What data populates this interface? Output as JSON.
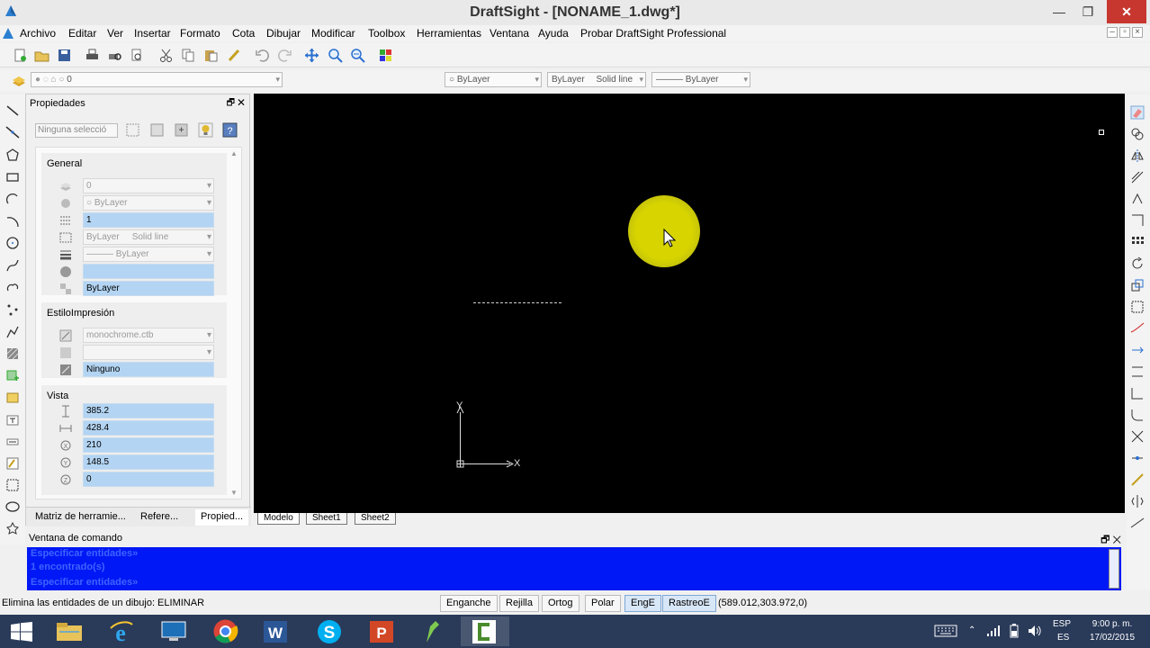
{
  "window": {
    "title": "DraftSight - [NONAME_1.dwg*]",
    "minimize_label": "—",
    "restore_label": "❐",
    "close_label": "✕"
  },
  "menu": [
    "Archivo",
    "Editar",
    "Ver",
    "Insertar",
    "Formato",
    "Cota",
    "Dibujar",
    "Modificar",
    "Toolbox",
    "Herramientas",
    "Ventana",
    "Ayuda",
    "Probar DraftSight Professional"
  ],
  "layer_bar": {
    "layer_value": "0",
    "color_combo": "ByLayer",
    "linestyle_combo_left": "ByLayer",
    "linestyle_combo_right": "Solid line",
    "lineweight_combo": "——— ByLayer"
  },
  "properties_panel": {
    "title": "Propiedades",
    "close_label": "✕",
    "float_label": "🗗",
    "selection_combo": "Ninguna selecció",
    "general": {
      "title": "General",
      "layer": "0",
      "color": "ByLayer",
      "linescale": "1",
      "linestyle_left": "ByLayer",
      "linestyle_right": "Solid line",
      "lineweight": "——— ByLayer",
      "thickness": "",
      "transparency": "ByLayer"
    },
    "print_style": {
      "title": "EstiloImpresión",
      "table": "monochrome.ctb",
      "style": "",
      "value": "Ninguno"
    },
    "view": {
      "title": "Vista",
      "height": "385.2",
      "width": "428.4",
      "center_x": "210",
      "center_y": "148.5",
      "center_z": "0"
    },
    "tabs": [
      "Matriz de herramie...",
      "Refere...",
      "Propied..."
    ]
  },
  "canvas": {
    "axis_y_label": "Y",
    "axis_x_label": "X"
  },
  "sheet_tabs": [
    "Modelo",
    "Sheet1",
    "Sheet2"
  ],
  "command_window": {
    "title": "Ventana de comando",
    "lines": [
      "Especificar entidades»",
      "1 encontrado(s)",
      "Especificar entidades»"
    ]
  },
  "status": {
    "message": "Elimina las entidades de un dibujo: ELIMINAR",
    "buttons": [
      "Enganche",
      "Rejilla",
      "Ortog",
      "Polar",
      "EngE",
      "RastreoE"
    ],
    "coords": "(589.012,303.972,0)"
  },
  "taskbar": {
    "lang_top": "ESP",
    "lang_bottom": "ES",
    "time": "9:00 p. m.",
    "date": "17/02/2015"
  },
  "colors": {
    "canvas_bg": "#000000",
    "command_bg": "#0018f5",
    "cursor_highlight": "#d7d400",
    "taskbar_bg": "#2a3a59"
  }
}
